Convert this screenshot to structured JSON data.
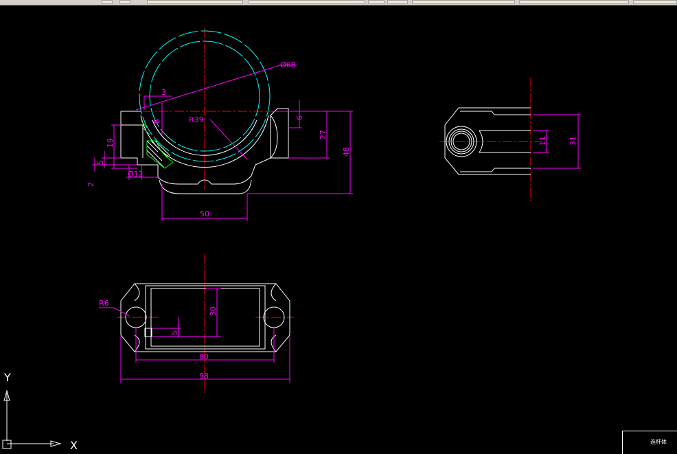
{
  "app": {
    "toolbar_buttons": 9
  },
  "drawing": {
    "title_block_label": "连杆体",
    "ucs": {
      "x_label": "X",
      "y_label": "Y"
    },
    "colors": {
      "background": "#000000",
      "outline": "#ffffff",
      "dimension": "#ff00ff",
      "centerline": "#ff0000",
      "hidden_circle": "#00ffff",
      "hatch": "#00ff00"
    },
    "dimensions": {
      "front": {
        "dia68": "Ø68",
        "r39": "R39",
        "d3": "3",
        "d8": "8",
        "d6": "6",
        "d27": "27",
        "d48": "48",
        "d19": "19",
        "d5": "5",
        "d2": "2",
        "d12": "Ø12",
        "d50": "50"
      },
      "side": {
        "d11": "11",
        "d31": "31"
      },
      "top": {
        "r6": "R6",
        "d30": "30",
        "d5": "5",
        "d80": "80",
        "d98": "98"
      }
    }
  }
}
